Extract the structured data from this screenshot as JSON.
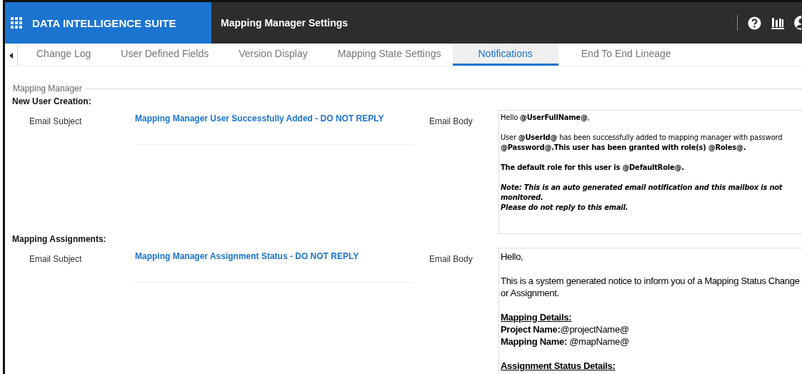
{
  "header": {
    "app_name": "DATA INTELLIGENCE SUITE",
    "page_title": "Mapping Manager Settings"
  },
  "tabs": [
    {
      "label": "Change Log",
      "selected": false
    },
    {
      "label": "User Defined Fields",
      "selected": false
    },
    {
      "label": "Version Display",
      "selected": false
    },
    {
      "label": "Mapping State Settings",
      "selected": false
    },
    {
      "label": "Notifications",
      "selected": true
    },
    {
      "label": "End To End Lineage",
      "selected": false
    }
  ],
  "group": {
    "legend": "Mapping Manager",
    "sections": [
      {
        "title": "New User Creation:",
        "subject_label": "Email Subject",
        "subject": "Mapping Manager User Successfully Added - DO NOT REPLY",
        "body_label": "Email Body",
        "kind": "compact",
        "body": [
          [
            {
              "kind": "text",
              "text": "Hello **@UserFullName@**,"
            }
          ],
          [
            {
              "kind": "text",
              "text": "User **@UserId@** has been successfully added to mapping manager with password **@Password@.This user has been granted with role(s) @Roles@.**"
            }
          ],
          [
            {
              "kind": "bold",
              "text": "The default role for this user is @DefaultRole@."
            }
          ],
          [
            {
              "kind": "bold-italic",
              "text": "Note: This is an auto generated email notification and this mailbox is not monitored."
            },
            {
              "kind": "bold-italic",
              "text": "Please do not reply to this email."
            }
          ]
        ]
      },
      {
        "title": "Mapping Assignments:",
        "subject_label": "Email Subject",
        "subject": "Mapping Manager Assignment Status - DO NOT REPLY",
        "body_label": "Email Body",
        "kind": "standard",
        "body": [
          [
            {
              "kind": "text",
              "text": "Hello,"
            }
          ],
          [
            {
              "kind": "text",
              "text": "This is a system generated notice to inform you of a Mapping Status Change or Assignment."
            }
          ],
          [
            {
              "kind": "heading",
              "text": "Mapping Details:"
            },
            {
              "kind": "text",
              "text": "**Project Name:**@projectName@"
            },
            {
              "kind": "text",
              "text": "**Mapping Name:** @mapName@"
            }
          ],
          [
            {
              "kind": "heading",
              "text": "Assignment Status Details:"
            }
          ]
        ]
      }
    ]
  }
}
